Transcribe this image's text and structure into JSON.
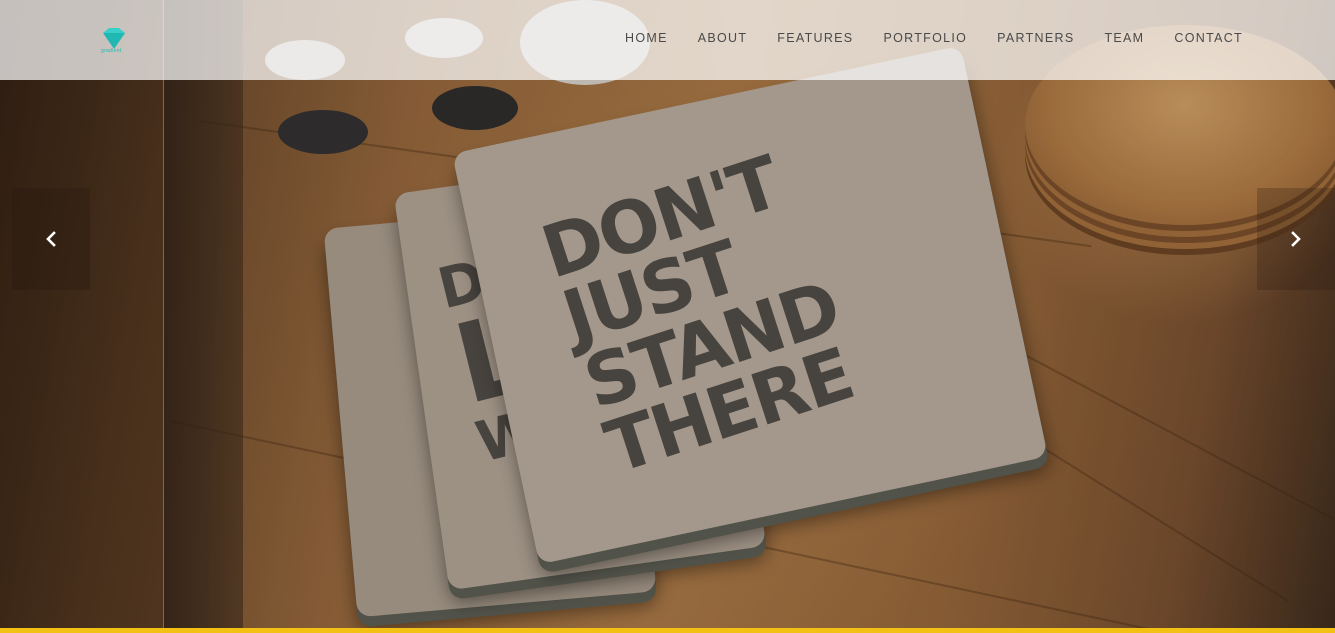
{
  "logo": {
    "text": "gradient",
    "icon": "diamond-icon",
    "color": "#1fb8b3"
  },
  "nav": {
    "items": [
      {
        "label": "HOME"
      },
      {
        "label": "ABOUT"
      },
      {
        "label": "FEATURES"
      },
      {
        "label": "PORTFOLIO"
      },
      {
        "label": "PARTNERS"
      },
      {
        "label": "TEAM"
      },
      {
        "label": "CONTACT"
      }
    ]
  },
  "slider": {
    "prev_icon": "chevron-left-icon",
    "next_icon": "chevron-right-icon",
    "notebook_front": [
      "DON'T",
      "JUST",
      "STAND",
      "THERE"
    ],
    "notebook_middle": [
      "DO",
      "L",
      "WA"
    ]
  },
  "colors": {
    "accent_bar": "#f2c114",
    "nav_text": "#4a4a4a"
  }
}
